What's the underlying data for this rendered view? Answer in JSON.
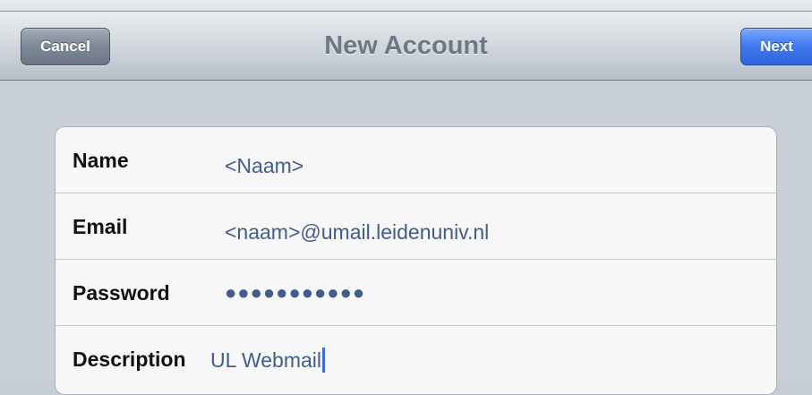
{
  "navbar": {
    "title": "New Account",
    "cancel_label": "Cancel",
    "next_label": "Next"
  },
  "form": {
    "rows": [
      {
        "label": "Name",
        "value": "<Naam>"
      },
      {
        "label": "Email",
        "value": "<naam>@umail.leidenuniv.nl"
      },
      {
        "label": "Password",
        "value": "●●●●●●●●●●●"
      },
      {
        "label": "Description",
        "value": "UL Webmail"
      }
    ]
  },
  "colors": {
    "value_text": "#405d8c",
    "next_button": "#3f79ec",
    "cancel_button": "#7c8896",
    "caret": "#3d6bd8"
  }
}
